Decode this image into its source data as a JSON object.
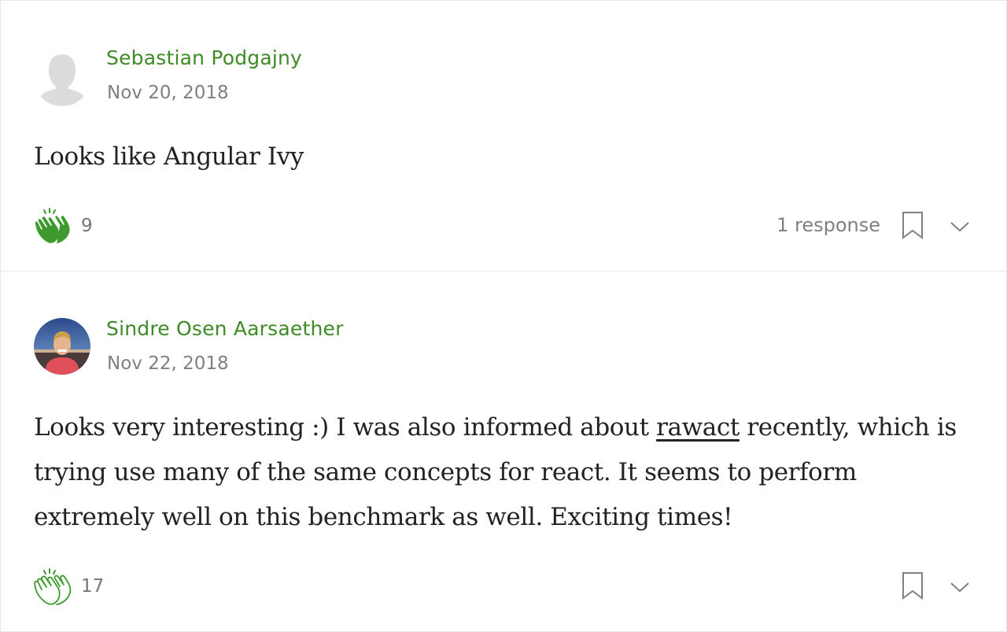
{
  "colors": {
    "author": "#3e8a26",
    "clap_filled": "#3e9a2e",
    "muted": "#808080",
    "text": "#222222",
    "divider": "#e6e6e6"
  },
  "responses": [
    {
      "author": "Sebastian Podgajny",
      "date": "Nov 20, 2018",
      "avatar_icon": "default-user-silhouette",
      "body": "Looks like Angular Ivy",
      "claps": "9",
      "clap_icon": "clap-filled-icon",
      "response_count": "1 response",
      "bookmark_icon": "bookmark-icon",
      "more_icon": "chevron-down-icon"
    },
    {
      "author": "Sindre Osen Aarsaether",
      "date": "Nov 22, 2018",
      "avatar_icon": "user-photo",
      "body_before_link": "Looks very interesting :) I was also informed about ",
      "body_link": "rawact",
      "body_after_link": " recently, which is trying use many of the same concepts for react. It seems to perform extremely well on this benchmark as well. Exciting times!",
      "claps": "17",
      "clap_icon": "clap-outline-icon",
      "bookmark_icon": "bookmark-icon",
      "more_icon": "chevron-down-icon"
    }
  ]
}
